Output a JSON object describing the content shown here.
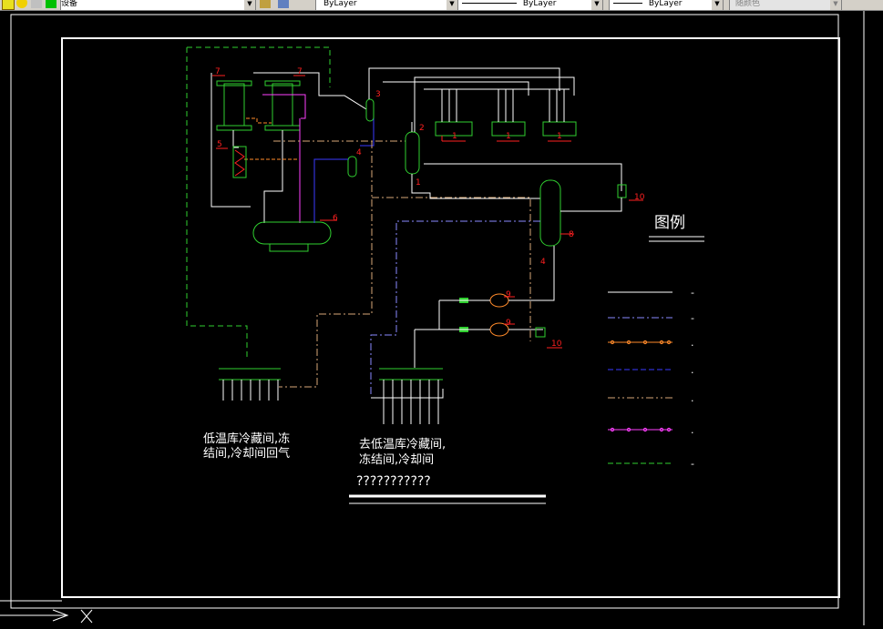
{
  "toolbar": {
    "layer_name": "设备",
    "color_control": "ByLayer",
    "linetype_control": "ByLayer",
    "lineweight_control": "ByLayer",
    "plotstyle_control": "随颜色"
  },
  "drawing": {
    "legend_title": "图例",
    "legend_rows": [
      {
        "color": "#ffffff",
        "style": "solid",
        "label": "-"
      },
      {
        "color": "#8a8aff",
        "style": "dashdot",
        "label": "-"
      },
      {
        "color": "#ff8a2a",
        "style": "marker",
        "label": "."
      },
      {
        "color": "#3a3aff",
        "style": "dashed",
        "label": "."
      },
      {
        "color": "#d8a878",
        "style": "dashdotdot",
        "label": "."
      },
      {
        "color": "#ff40ff",
        "style": "marker",
        "label": "."
      },
      {
        "color": "#30d030",
        "style": "dashed",
        "label": "-"
      }
    ],
    "left_caption_line1": "低温库冷藏间,冻",
    "left_caption_line2": "结间,冷却间回气",
    "mid_caption_line1": "去低温库冷藏间,",
    "mid_caption_line2": "冻结间,冷却间",
    "mid_caption_line3": "???????????",
    "component_labels": [
      "7",
      "7",
      "3",
      "2",
      "1",
      "6",
      "4",
      "5",
      "8",
      "9",
      "9",
      "10",
      "10",
      "4",
      "1",
      "1",
      "1"
    ]
  },
  "colors": {
    "background": "#000000",
    "white": "#ffffff",
    "green": "#30d030",
    "red": "#ff2020",
    "magenta": "#ff40ff",
    "orange": "#ff8a2a",
    "blue": "#3a3aff",
    "lightblue": "#8a8aff",
    "tan": "#d8a878"
  }
}
